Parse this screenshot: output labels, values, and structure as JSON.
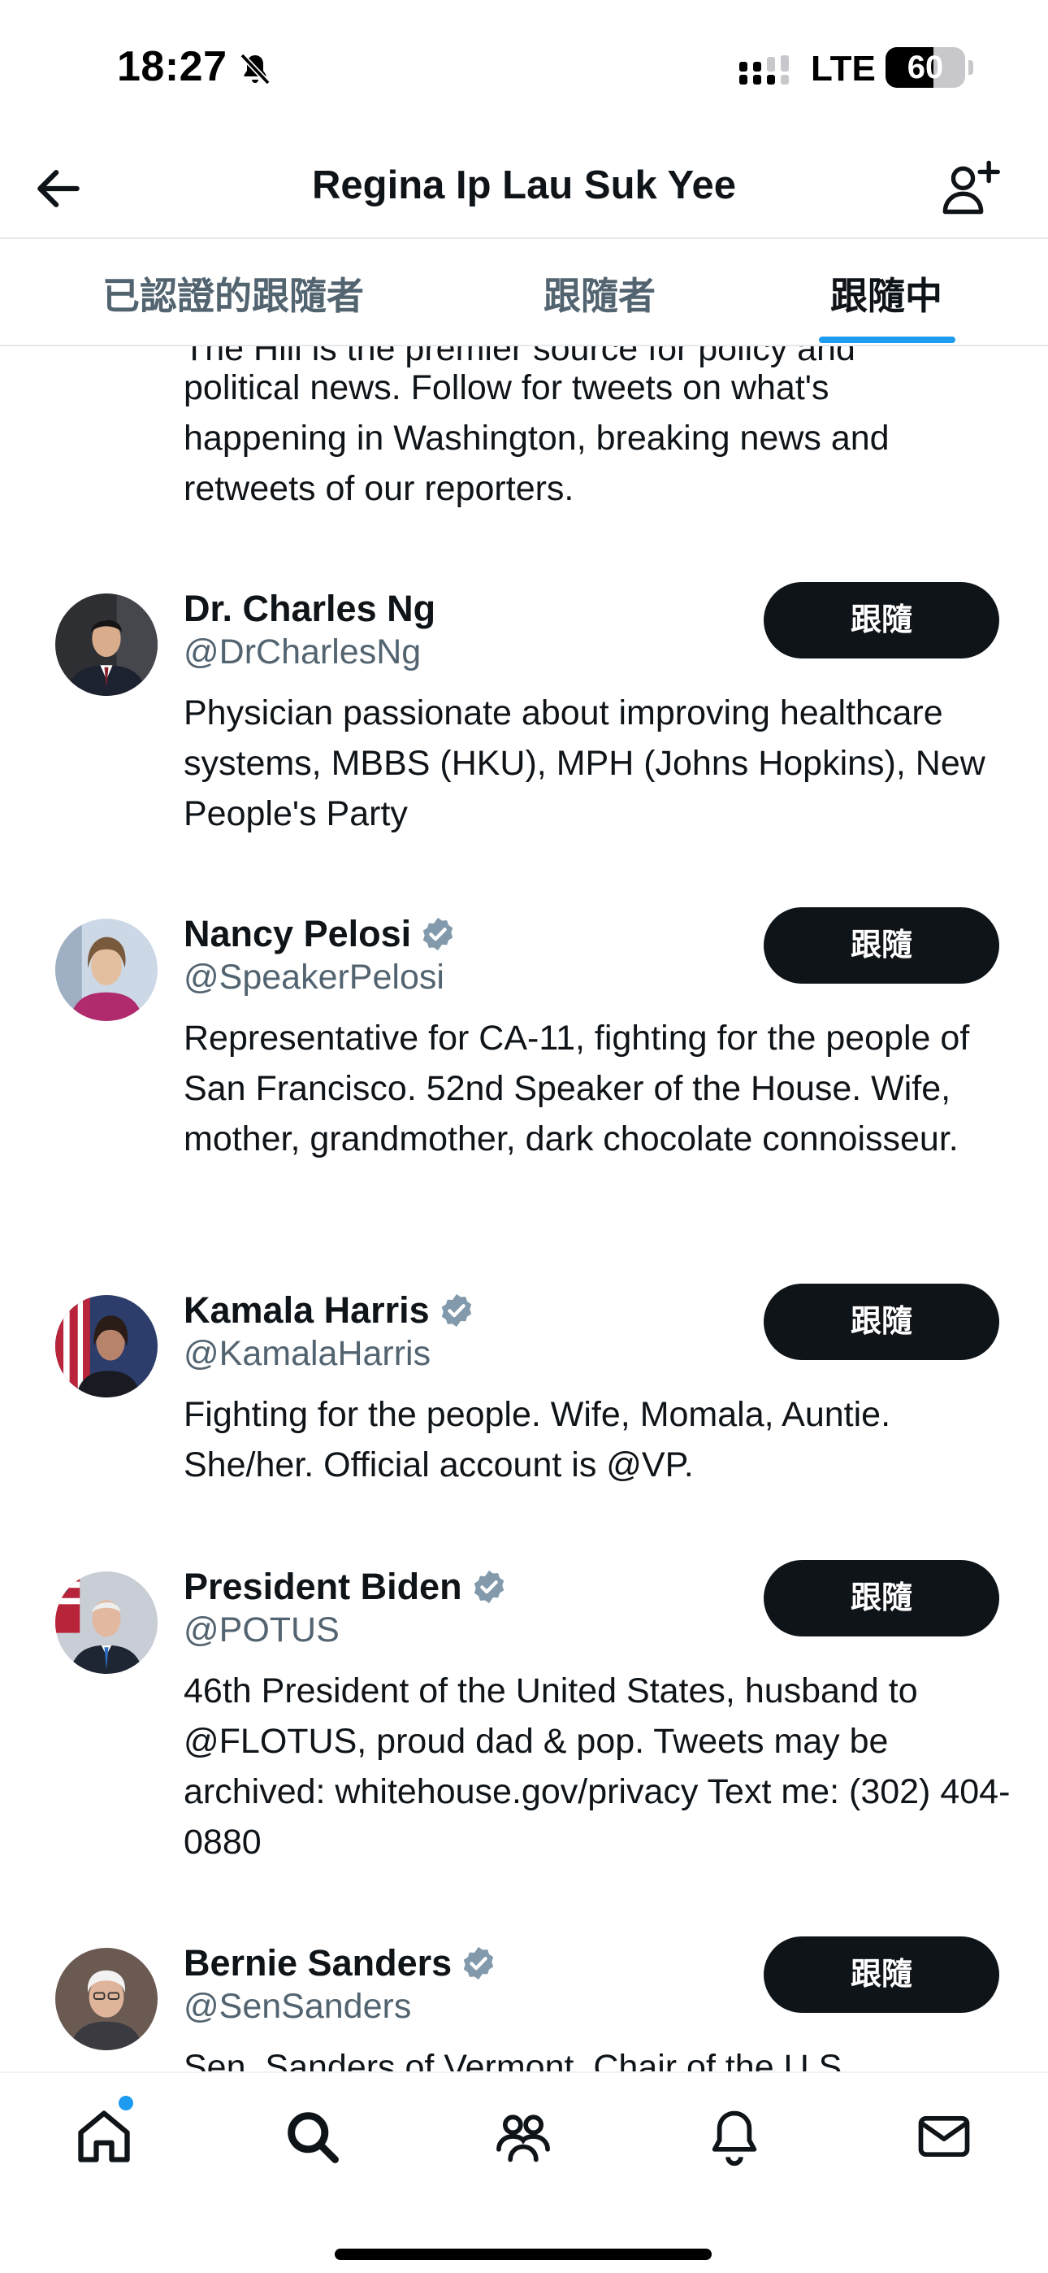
{
  "status_bar": {
    "time": "18:27",
    "network": "LTE",
    "battery_level": "60",
    "battery_fraction": 0.6
  },
  "header": {
    "title": "Regina Ip Lau Suk Yee"
  },
  "tabs": [
    {
      "label": "已認證的跟隨者",
      "active": false
    },
    {
      "label": "跟隨者",
      "active": false
    },
    {
      "label": "跟隨中",
      "active": true
    }
  ],
  "partial_bio": {
    "top_line": "The Hill is the premier source for policy and",
    "lines": [
      "political news. Follow for tweets on what's",
      "happening in Washington, breaking news and",
      "retweets of our reporters."
    ]
  },
  "users": [
    {
      "name": "Dr. Charles Ng",
      "handle": "@DrCharlesNg",
      "verified": false,
      "button": "跟隨",
      "bio": "Physician passionate about improving healthcare systems, MBBS (HKU), MPH (Johns Hopkins), New People's Party"
    },
    {
      "name": "Nancy Pelosi",
      "handle": "@SpeakerPelosi",
      "verified": true,
      "button": "跟隨",
      "bio": "Representative for CA-11, fighting for the people of San Francisco. 52nd Speaker of the House. Wife, mother, grandmother, dark chocolate connoisseur."
    },
    {
      "name": "Kamala Harris",
      "handle": "@KamalaHarris",
      "verified": true,
      "button": "跟隨",
      "bio": "Fighting for the people. Wife, Momala, Auntie. She/her. Official account is @VP."
    },
    {
      "name": "President Biden",
      "handle": "@POTUS",
      "verified": true,
      "button": "跟隨",
      "bio": "46th President of the United States, husband to @FLOTUS, proud dad & pop. Tweets may be archived: whitehouse.gov/privacy Text me: (302) 404-0880"
    },
    {
      "name": "Bernie Sanders",
      "handle": "@SenSanders",
      "verified": true,
      "button": "跟隨",
      "bio": "Sen. Sanders of Vermont, Chair of the U.S."
    }
  ],
  "tabbar": {
    "items": [
      "home-icon",
      "search-icon",
      "communities-icon",
      "notifications-icon",
      "messages-icon"
    ],
    "home_has_notification": true
  },
  "colors": {
    "accent": "#1d9bf0",
    "text": "#0f1419",
    "secondary": "#536471",
    "verified": "#829aab",
    "button": "#0f1419"
  }
}
